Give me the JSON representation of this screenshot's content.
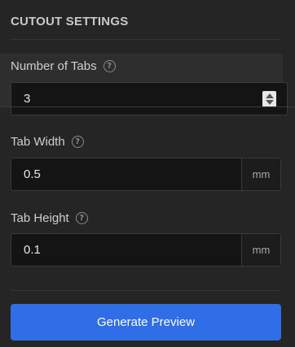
{
  "section": {
    "title": "CUTOUT SETTINGS"
  },
  "fields": [
    {
      "label": "Number of Tabs",
      "help_icon": "?",
      "value": "3",
      "control": "number-stepper"
    },
    {
      "label": "Tab Width",
      "help_icon": "?",
      "value": "0.5",
      "unit": "mm"
    },
    {
      "label": "Tab Height",
      "help_icon": "?",
      "value": "0.1",
      "unit": "mm"
    }
  ],
  "actions": {
    "generate_label": "Generate Preview"
  },
  "colors": {
    "background": "#252525",
    "input_background": "#141414",
    "accent": "#2f6ee6"
  },
  "icons": {
    "help": "question-circle-icon",
    "stepper": "up-down-arrows-icon"
  }
}
